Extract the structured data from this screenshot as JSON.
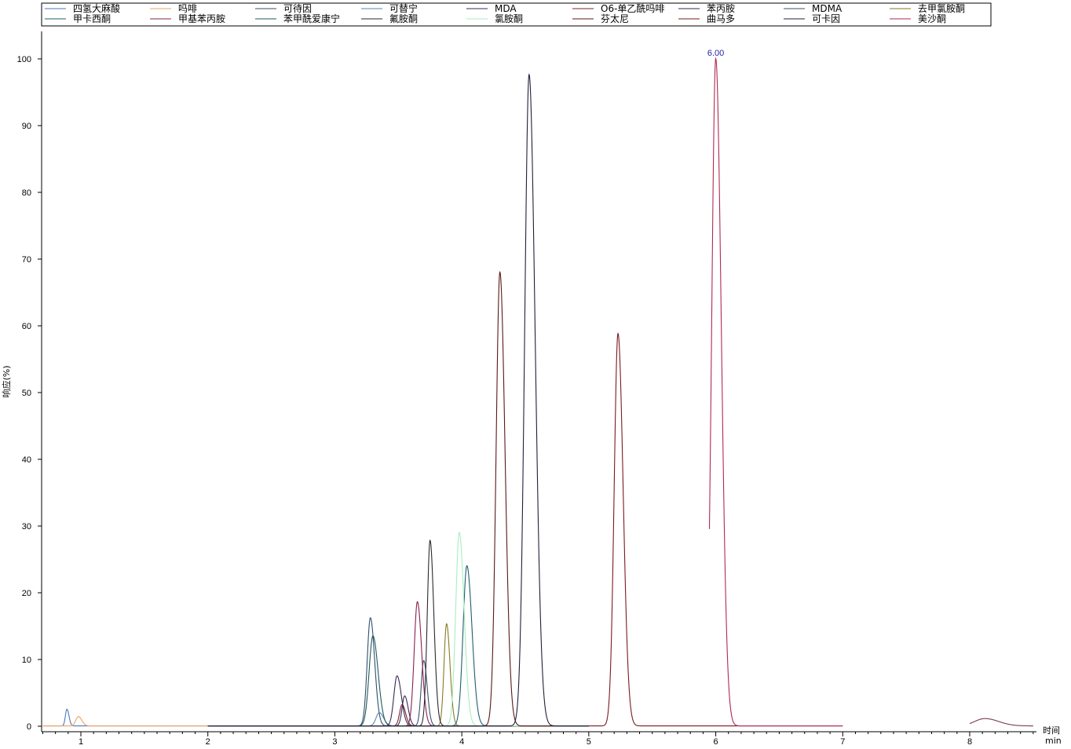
{
  "chart_data": {
    "type": "line",
    "title": "",
    "xlabel": "时间",
    "xunit": "min",
    "ylabel": "响应(%)",
    "xlim": [
      0.7,
      8.5
    ],
    "ylim": [
      0,
      100
    ],
    "x_ticks": [
      "1",
      "2",
      "3",
      "4",
      "5",
      "6",
      "7",
      "8"
    ],
    "y_ticks": [
      "0",
      "10",
      "20",
      "30",
      "40",
      "50",
      "60",
      "70",
      "80",
      "90",
      "100"
    ],
    "grid": false,
    "legend_position": "top",
    "annotations": [
      {
        "x": 6.0,
        "y": 100,
        "text": "6.00"
      }
    ],
    "series": [
      {
        "name": "四氢大麻酸",
        "color": "#4a78b8",
        "peaks": [
          [
            0.89,
            2.5,
            0.012
          ]
        ],
        "range": [
          0.7,
          2.0
        ]
      },
      {
        "name": "吗啡",
        "color": "#f0a060",
        "peaks": [
          [
            0.98,
            1.4,
            0.02
          ]
        ],
        "range": [
          0.7,
          2.0
        ]
      },
      {
        "name": "可待因",
        "color": "#2f4f6f",
        "peaks": [
          [
            3.28,
            16.2,
            0.025
          ]
        ],
        "range": [
          2.0,
          5.0
        ]
      },
      {
        "name": "可替宁",
        "color": "#5a87b3",
        "peaks": [
          [
            3.35,
            2.0,
            0.025
          ]
        ],
        "range": [
          2.0,
          5.0
        ]
      },
      {
        "name": "MDA",
        "color": "#3a2a5a",
        "peaks": [
          [
            3.55,
            4.5,
            0.02
          ]
        ],
        "range": [
          2.0,
          5.0
        ]
      },
      {
        "name": "O6-单乙酰吗啡",
        "color": "#7a2530",
        "peaks": [
          [
            3.53,
            3.2,
            0.02
          ]
        ],
        "range": [
          2.0,
          5.0
        ]
      },
      {
        "name": "苯丙胺",
        "color": "#3b2a50",
        "peaks": [
          [
            3.49,
            7.5,
            0.025
          ]
        ],
        "range": [
          2.0,
          5.0
        ]
      },
      {
        "name": "MDMA",
        "color": "#38506a",
        "peaks": [
          [
            3.7,
            9.8,
            0.02
          ]
        ],
        "range": [
          2.0,
          5.0
        ]
      },
      {
        "name": "去甲氯胺酮",
        "color": "#8a7a20",
        "peaks": [
          [
            3.88,
            15.3,
            0.02
          ]
        ],
        "range": [
          2.0,
          5.0
        ]
      },
      {
        "name": "甲卡西酮",
        "color": "#1f5f6a",
        "peaks": [
          [
            4.04,
            24.0,
            0.03
          ]
        ],
        "range": [
          2.0,
          5.0
        ]
      },
      {
        "name": "甲基苯丙胺",
        "color": "#8a2050",
        "peaks": [
          [
            3.65,
            18.6,
            0.025
          ]
        ],
        "range": [
          2.0,
          5.0
        ]
      },
      {
        "name": "苯甲酰爱康宁",
        "color": "#1f5a5a",
        "peaks": [
          [
            3.3,
            13.5,
            0.03
          ]
        ],
        "range": [
          2.0,
          5.0
        ]
      },
      {
        "name": "氟胺酮",
        "color": "#2a2a30",
        "peaks": [
          [
            3.75,
            27.8,
            0.022
          ]
        ],
        "range": [
          2.0,
          5.0
        ]
      },
      {
        "name": "氯胺酮",
        "color": "#a8eec0",
        "peaks": [
          [
            3.98,
            29.0,
            0.028
          ]
        ],
        "range": [
          2.0,
          5.0
        ]
      },
      {
        "name": "芬太尼",
        "color": "#5a1818",
        "peaks": [
          [
            4.3,
            68.0,
            0.03
          ]
        ],
        "range": [
          2.0,
          5.0
        ]
      },
      {
        "name": "曲马多",
        "color": "#7a1a20",
        "peaks": [
          [
            5.23,
            58.8,
            0.03
          ]
        ],
        "range": [
          5.0,
          7.0
        ]
      },
      {
        "name": "可卡因",
        "color": "#20203a",
        "peaks": [
          [
            4.53,
            97.6,
            0.035
          ]
        ],
        "range": [
          2.0,
          5.0
        ]
      },
      {
        "name": "美沙酮",
        "color": "#b02a50",
        "peaks": [
          [
            6.0,
            100.0,
            0.032
          ]
        ],
        "range": [
          5.95,
          7.0
        ]
      },
      {
        "name": "",
        "color": "#7a3a50",
        "peaks": [
          [
            8.12,
            1.1,
            0.08
          ]
        ],
        "range": [
          8.0,
          8.5
        ]
      }
    ]
  }
}
